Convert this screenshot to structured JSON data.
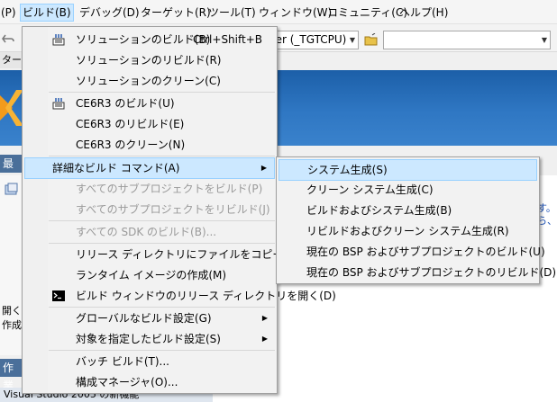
{
  "menubar": {
    "items": [
      {
        "label": "(P)"
      },
      {
        "label": "ビルド(B)"
      },
      {
        "label": "デバッグ(D)"
      },
      {
        "label": "ターゲット(R)"
      },
      {
        "label": "ツール(T)"
      },
      {
        "label": "ウィンドウ(W)"
      },
      {
        "label": "コミュニティ(C)"
      },
      {
        "label": "ヘルプ(H)"
      }
    ]
  },
  "toolbar": {
    "config_combo_value": "der (_TGTCPU)"
  },
  "tabstrip": {
    "label": "タート"
  },
  "background": {
    "recent_header": "最近",
    "open_label": "開く:",
    "create_label": "作成",
    "work_header": "作業",
    "vs_text": "Visual Studio 2005 の新機能",
    "right_text_1": "す。",
    "right_text_2": "ら、[I"
  },
  "build_menu": {
    "items": [
      {
        "label": "ソリューションのビルド(B)",
        "shortcut": "Ctrl+Shift+B",
        "icon": "build-solution-icon"
      },
      {
        "label": "ソリューションのリビルド(R)"
      },
      {
        "label": "ソリューションのクリーン(C)"
      },
      {
        "label": "CE6R3 のビルド(U)",
        "icon": "build-project-icon"
      },
      {
        "label": "CE6R3 のリビルド(E)"
      },
      {
        "label": "CE6R3 のクリーン(N)"
      },
      {
        "label": "詳細なビルド コマンド(A)"
      },
      {
        "label": "すべてのサブプロジェクトをビルド(P)"
      },
      {
        "label": "すべてのサブプロジェクトをリビルド(J)"
      },
      {
        "label": "すべての SDK のビルド(B)..."
      },
      {
        "label": "リリース ディレクトリにファイルをコピー(R)"
      },
      {
        "label": "ランタイム イメージの作成(M)"
      },
      {
        "label": "ビルド ウィンドウのリリース ディレクトリを開く(D)",
        "icon": "command-prompt-icon"
      },
      {
        "label": "グローバルなビルド設定(G)"
      },
      {
        "label": "対象を指定したビルド設定(S)"
      },
      {
        "label": "バッチ ビルド(T)..."
      },
      {
        "label": "構成マネージャ(O)..."
      }
    ]
  },
  "advanced_submenu": {
    "items": [
      {
        "label": "システム生成(S)"
      },
      {
        "label": "クリーン システム生成(C)"
      },
      {
        "label": "ビルドおよびシステム生成(B)"
      },
      {
        "label": "リビルドおよびクリーン システム生成(R)"
      },
      {
        "label": "現在の BSP およびサブプロジェクトのビルド(U)"
      },
      {
        "label": "現在の BSP およびサブプロジェクトのリビルド(D)"
      }
    ]
  },
  "colors": {
    "highlight": "#cce8ff",
    "highlight_border": "#99d1ff",
    "banner": "#2f77c3",
    "section_bar": "#4a6f9a",
    "disabled_text": "#9a9a9a"
  }
}
